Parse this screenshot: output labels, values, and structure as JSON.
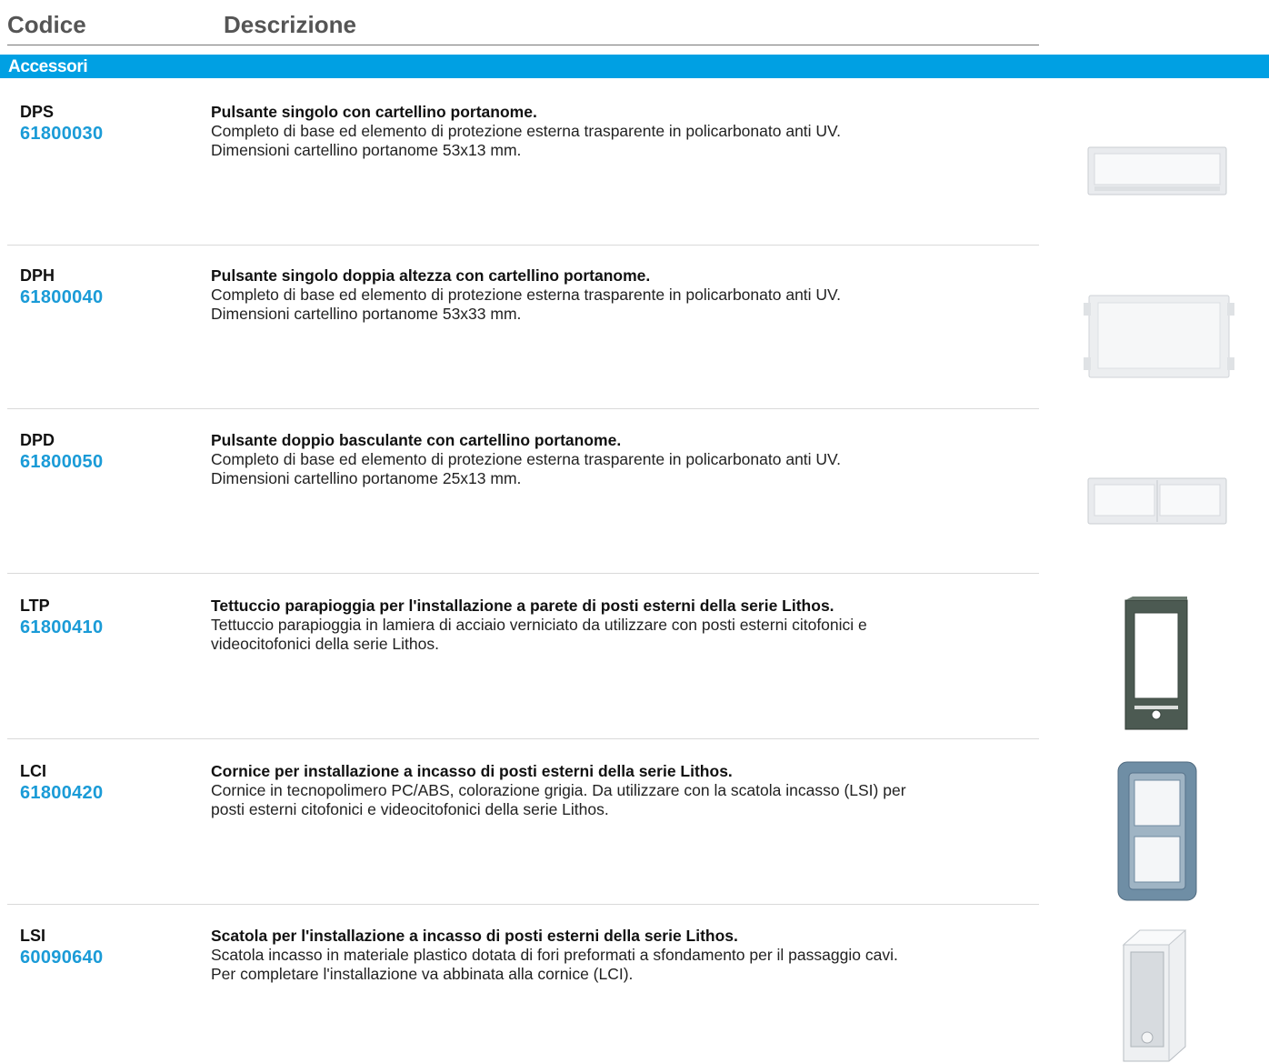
{
  "header": {
    "code_label": "Codice",
    "description_label": "Descrizione"
  },
  "section": {
    "title": "Accessori"
  },
  "colors": {
    "accent": "#00a0e3",
    "article": "#1a9bd7"
  },
  "items": [
    {
      "code": "DPS",
      "article": "61800030",
      "title": "Pulsante singolo con cartellino portanome.",
      "body": "Completo di base ed elemento di protezione esterna trasparente in policarbonato anti UV. Dimensioni cartellino portanome 53x13 mm.",
      "image": "single-button-nameplate"
    },
    {
      "code": "DPH",
      "article": "61800040",
      "title": "Pulsante singolo doppia altezza con cartellino portanome.",
      "body": "Completo di base ed elemento di protezione esterna trasparente in policarbonato anti UV. Dimensioni cartellino portanome 53x33 mm.",
      "image": "double-height-button-nameplate"
    },
    {
      "code": "DPD",
      "article": "61800050",
      "title": "Pulsante doppio basculante con cartellino portanome.",
      "body": "Completo di base ed elemento di protezione esterna trasparente in policarbonato anti UV. Dimensioni cartellino portanome 25x13 mm.",
      "image": "double-rocker-button-nameplate"
    },
    {
      "code": "LTP",
      "article": "61800410",
      "title": "Tettuccio parapioggia per l'installazione a parete di posti esterni della serie Lithos.",
      "body": "Tettuccio parapioggia in lamiera di acciaio verniciato da utilizzare con posti esterni citofonici e videocitofonici della serie Lithos.",
      "image": "rain-canopy"
    },
    {
      "code": "LCI",
      "article": "61800420",
      "title": "Cornice per installazione a incasso di posti esterni della serie Lithos.",
      "body": "Cornice in tecnopolimero PC/ABS, colorazione grigia. Da utilizzare con la scatola incasso (LSI) per posti esterni citofonici e videocitofonici della serie Lithos.",
      "image": "flush-mount-frame"
    },
    {
      "code": "LSI",
      "article": "60090640",
      "title": "Scatola per l'installazione a incasso di posti esterni della serie Lithos.",
      "body": "Scatola incasso in materiale plastico dotata di fori preformati a sfondamento per il passaggio cavi. Per completare l'installazione va abbinata alla cornice (LCI).",
      "image": "flush-mount-box"
    }
  ]
}
